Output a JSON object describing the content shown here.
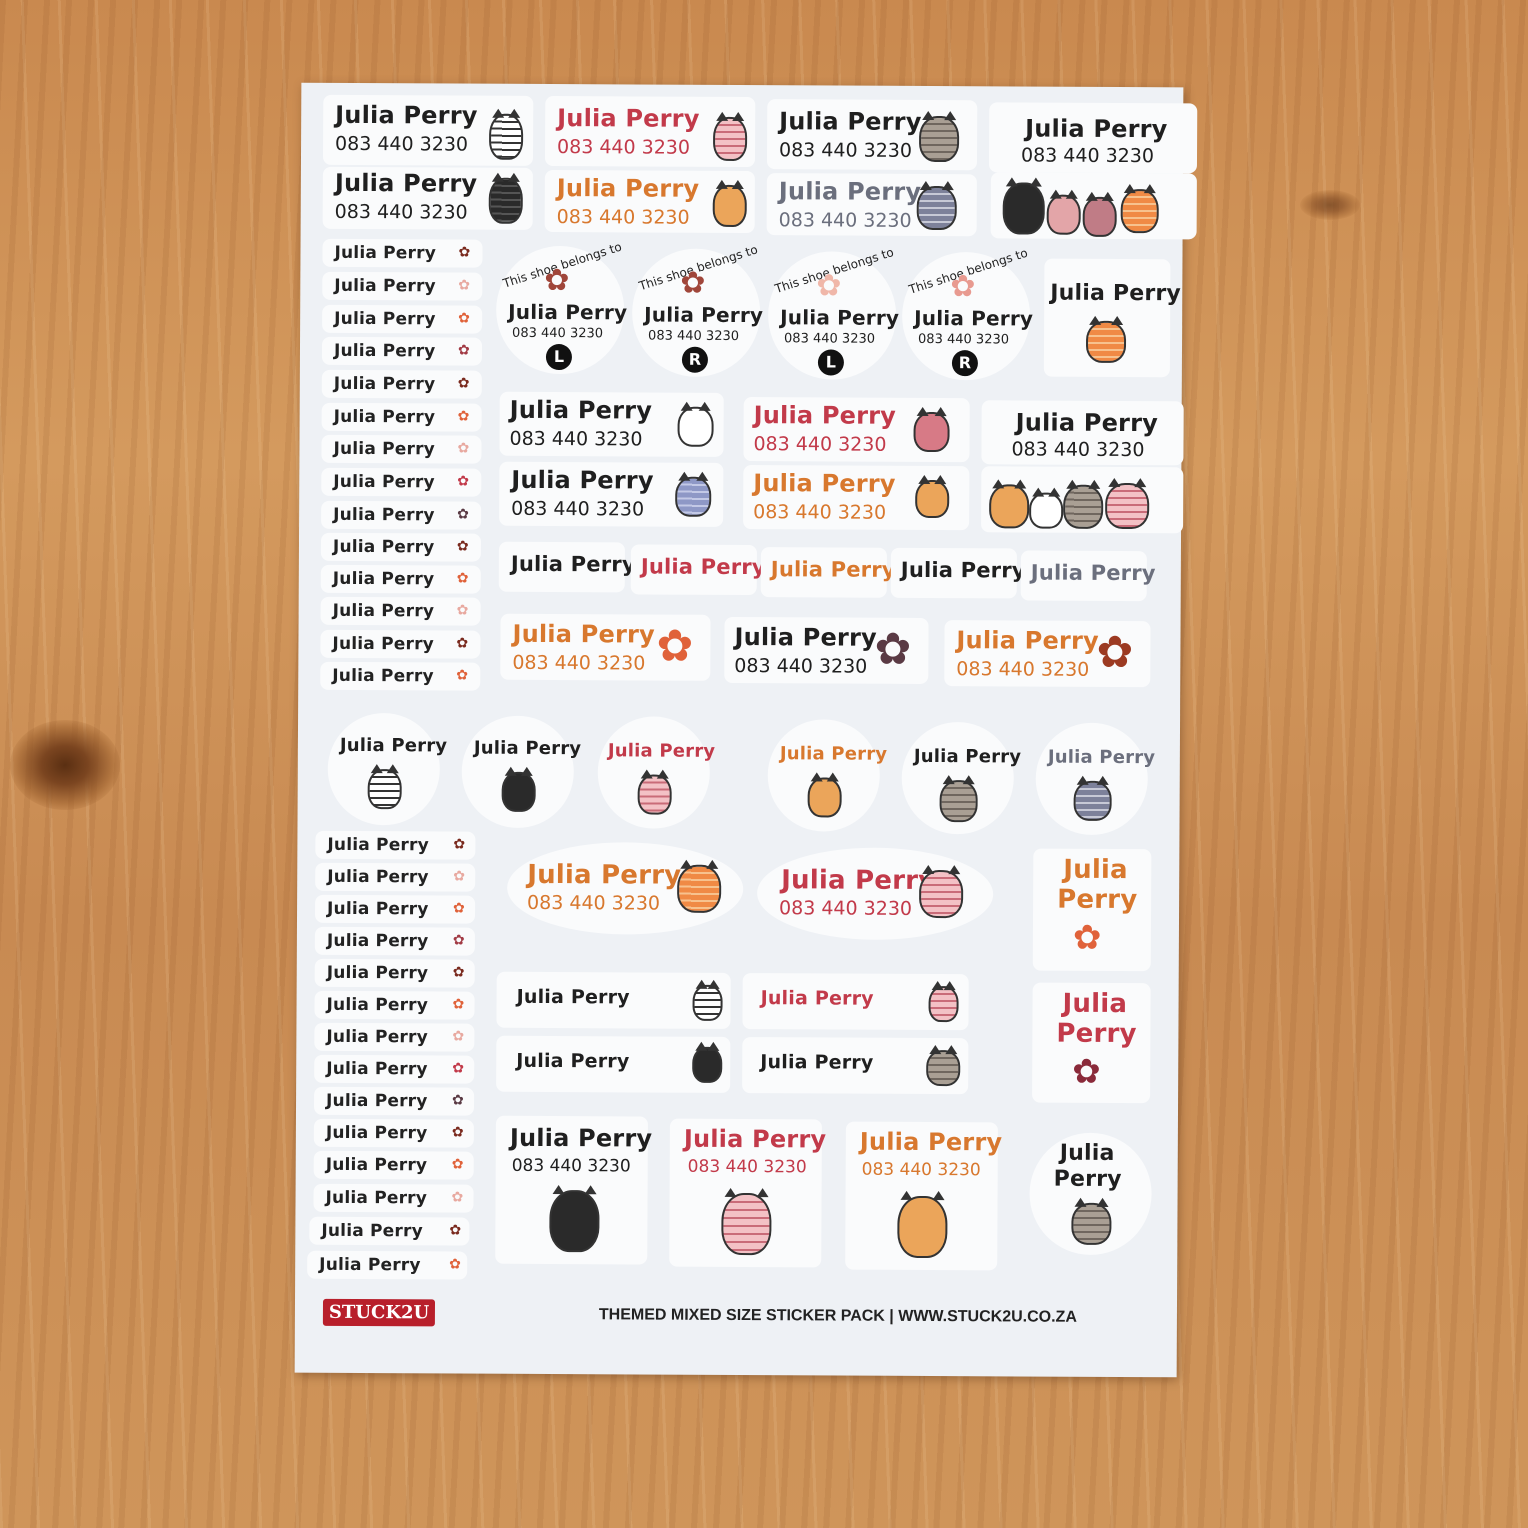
{
  "sticker": {
    "name": "Julia Perry",
    "phone": "083 440 3230",
    "shoe_line": "This shoe belongs to",
    "left": "L",
    "right": "R",
    "name_first": "Julia",
    "name_last": "Perry"
  },
  "footer": {
    "text": "THEMED MIXED SIZE STICKER PACK | WWW.STUCK2U.CO.ZA",
    "logo": "STUCK2U"
  },
  "palette": {
    "black": "#1f1f1f",
    "red": "#c23a4a",
    "orange": "#d8782e",
    "grey": "#6b6f7d",
    "paw_dark": "#7a2a1e",
    "paw_pink": "#e8a9a0",
    "paw_orange": "#e0623a"
  },
  "icons": [
    "cat-icon",
    "paw-icon",
    "group-of-cats-icon"
  ]
}
